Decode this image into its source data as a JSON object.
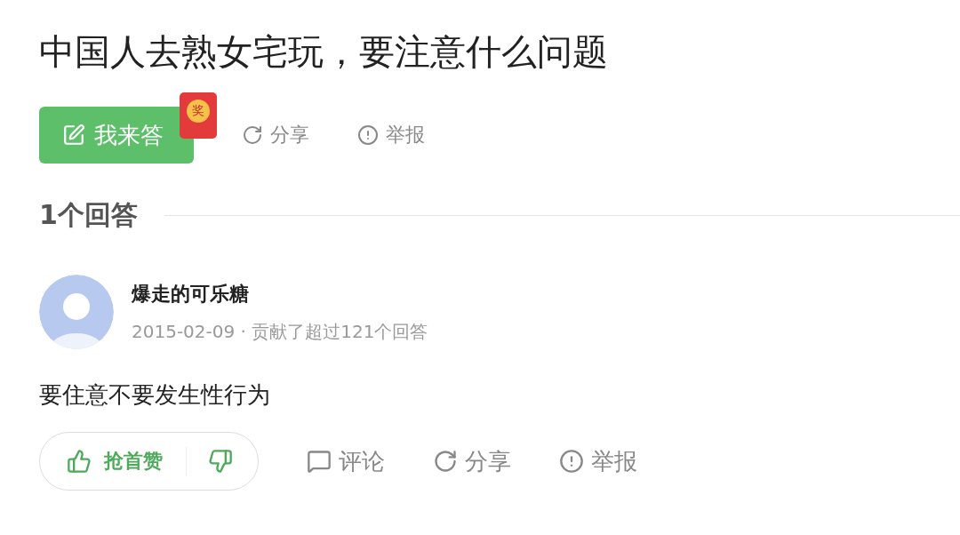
{
  "question": {
    "title": "中国人去熟女宅玩，要注意什么问题",
    "actions": [
      {
        "kind": "answer",
        "label": "我来答",
        "badge": "奖"
      },
      {
        "kind": "share",
        "label": "分享"
      },
      {
        "kind": "report",
        "label": "举报"
      }
    ]
  },
  "answers_header": "1个回答",
  "answers": [
    {
      "author": "爆走的可乐糖",
      "meta": "2015-02-09 · 贡献了超过121个回答",
      "text": "要住意不要发生性行为",
      "vote": {
        "up_label": "抢首赞"
      },
      "actions": [
        {
          "kind": "comment",
          "label": "评论"
        },
        {
          "kind": "share",
          "label": "分享"
        },
        {
          "kind": "report",
          "label": "举报"
        }
      ]
    }
  ]
}
